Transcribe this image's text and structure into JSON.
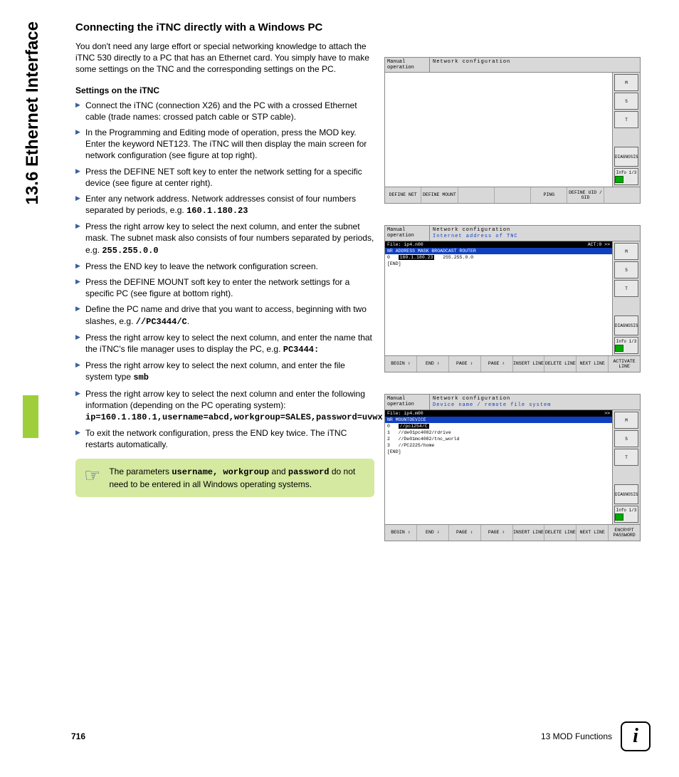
{
  "side_tab": "13.6 Ethernet Interface",
  "heading": "Connecting the iTNC directly with a Windows PC",
  "intro": "You don't need any large effort or special networking knowledge to attach the iTNC 530 directly to a PC that has an Ethernet card. You simply have to make some settings on the TNC and the corresponding settings on the PC.",
  "subheading": "Settings on the iTNC",
  "bullets": [
    {
      "text": "Connect the iTNC (connection X26) and the PC with a crossed Ethernet cable (trade names: crossed patch cable or STP cable)."
    },
    {
      "text": "In the Programming and Editing mode of operation, press the MOD key. Enter the keyword NET123. The iTNC will then display the main screen for network configuration (see figure at top right)."
    },
    {
      "text": "Press the DEFINE NET soft key to enter the network setting for a specific device (see figure at center right)."
    },
    {
      "text": "Enter any network address. Network addresses consist of four numbers separated by periods, e.g. ",
      "mono": "160.1.180.23"
    },
    {
      "text": "Press the right arrow key to select the next column, and enter the subnet mask. The subnet mask also consists of four numbers separated by periods, e.g. ",
      "mono": "255.255.0.0"
    },
    {
      "text": "Press the END key to leave the network configuration screen."
    },
    {
      "text": "Press the DEFINE MOUNT soft key to enter the network settings for a specific PC (see figure at bottom right)."
    },
    {
      "text": "Define the PC name and drive that you want to access, beginning with two slashes, e.g. ",
      "mono": "//PC3444/C",
      "suffix": "."
    },
    {
      "text": "Press the right arrow key to select the next column, and enter the name that the iTNC's file manager uses to display the PC, e.g. ",
      "mono": "PC3444:"
    },
    {
      "text": "Press the right arrow key to select the next column, and enter the file system type ",
      "mono": "smb"
    },
    {
      "text": "Press the right arrow key to select the next column and enter the following information (depending on the PC operating system): ",
      "mono2": "ip=160.1.180.1,username=abcd,workgroup=SALES,password=uvwx"
    },
    {
      "text": "To exit the network configuration, press the END key twice. The iTNC restarts automatically."
    }
  ],
  "note": {
    "pre": "The parameters ",
    "mono": "username, workgroup",
    "mid": " and ",
    "mono2": "password",
    "post": " do not need to be entered in all Windows operating systems."
  },
  "screens": {
    "s1": {
      "mode": "Manual operation",
      "title": "Network configuration",
      "side": {
        "m": "M",
        "s": "S",
        "t": "T",
        "diag": "DIAGNOSIS",
        "info": "Info 1/3"
      },
      "softkeys": [
        "DEFINE NET",
        "DEFINE MOUNT",
        "",
        "",
        "PING",
        "DEFINE UID / GID",
        ""
      ]
    },
    "s2": {
      "mode": "Manual operation",
      "title": "Network configuration",
      "subtitle": "Internet address of TNC",
      "filebar_left": "File: ip4.n00",
      "filebar_right": "ACT:0      >>",
      "cols": "NR  ADDRESS        MASK           BROADCAST    ROUTER",
      "rows": [
        "0   160.1.180.23   255.255.0.0",
        "[END]"
      ],
      "side": {
        "m": "M",
        "s": "S",
        "t": "T",
        "diag": "DIAGNOSIS",
        "info": "Info 1/3"
      },
      "softkeys": [
        "BEGIN ⇧",
        "END ⇩",
        "PAGE ⇧",
        "PAGE ⇩",
        "INSERT LINE",
        "DELETE LINE",
        "NEXT LINE",
        "ACTIVATE LINE"
      ]
    },
    "s3": {
      "mode": "Manual operation",
      "title": "Network configuration",
      "subtitle": "Device name / remote file system",
      "filebar_left": "File: ip4.m00",
      "filebar_right": ">>",
      "cols": "NR  MOUNTDEVICE",
      "rows": [
        "0   //pc1254/C",
        "1   //de01pc4082/rdrive",
        "2   //De01mc4082/tnc_world",
        "3   //PC2225/home",
        "[END]"
      ],
      "side": {
        "m": "M",
        "s": "S",
        "t": "T",
        "diag": "DIAGNOSIS",
        "info": "Info 1/3"
      },
      "softkeys": [
        "BEGIN ⇧",
        "END ⇩",
        "PAGE ⇧",
        "PAGE ⇩",
        "INSERT LINE",
        "DELETE LINE",
        "NEXT LINE",
        "ENCRYPT PASSWORD"
      ]
    }
  },
  "footer": {
    "page": "716",
    "chapter": "13 MOD Functions",
    "badge": "i"
  }
}
